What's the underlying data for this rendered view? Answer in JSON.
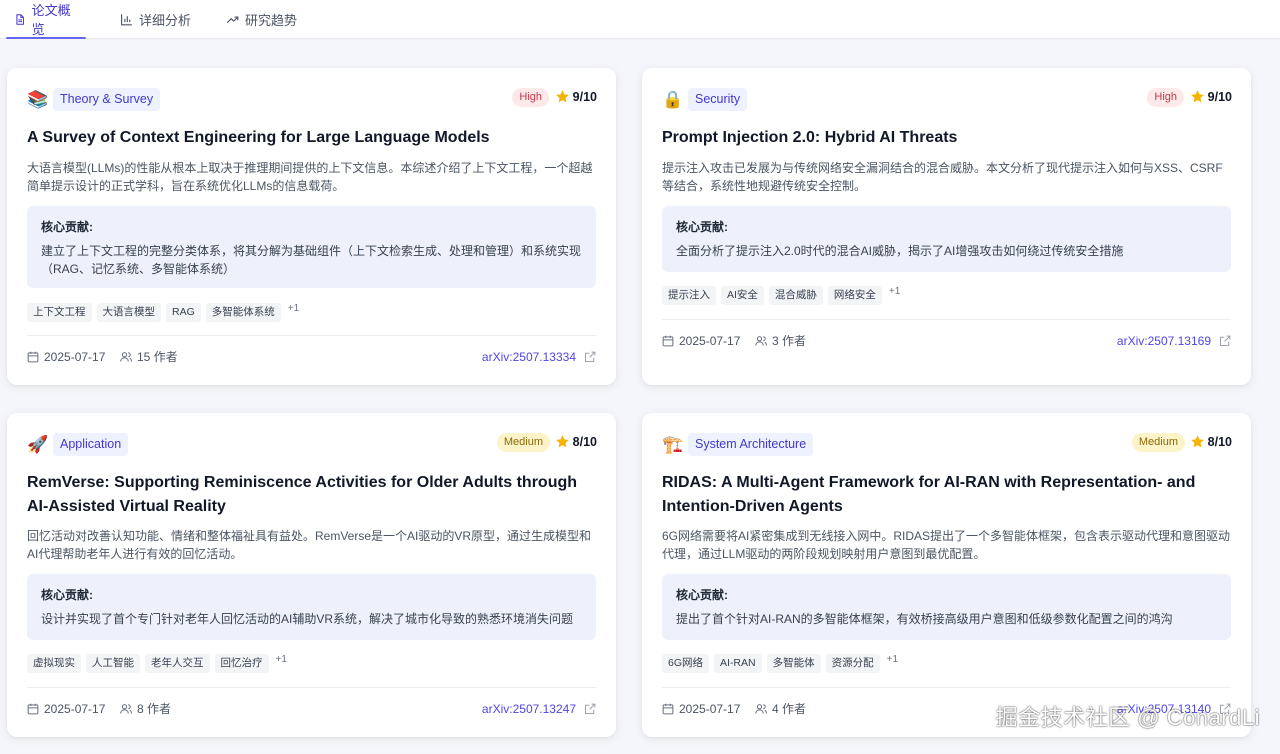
{
  "tabs": [
    {
      "label": "论文概览",
      "icon": "document-icon",
      "active": true
    },
    {
      "label": "详细分析",
      "icon": "bar-chart-icon",
      "active": false
    },
    {
      "label": "研究趋势",
      "icon": "trending-up-icon",
      "active": false
    }
  ],
  "contribution_label": "核心贡献:",
  "papers": [
    {
      "emoji": "📚",
      "category": "Theory & Survey",
      "priority": "High",
      "score": "9/10",
      "title": "A Survey of Context Engineering for Large Language Models",
      "summary": "大语言模型(LLMs)的性能从根本上取决于推理期间提供的上下文信息。本综述介绍了上下文工程，一个超越简单提示设计的正式学科，旨在系统优化LLMs的信息载荷。",
      "contribution": "建立了上下文工程的完整分类体系，将其分解为基础组件（上下文检索生成、处理和管理）和系统实现（RAG、记忆系统、多智能体系统）",
      "tags": [
        "上下文工程",
        "大语言模型",
        "RAG",
        "多智能体系统"
      ],
      "more": "+1",
      "date": "2025-07-17",
      "authors": "15 作者",
      "arxiv": "arXiv:2507.13334"
    },
    {
      "emoji": "🔒",
      "category": "Security",
      "priority": "High",
      "score": "9/10",
      "title": "Prompt Injection 2.0: Hybrid AI Threats",
      "summary": "提示注入攻击已发展为与传统网络安全漏洞结合的混合威胁。本文分析了现代提示注入如何与XSS、CSRF等结合，系统性地规避传统安全控制。",
      "contribution": "全面分析了提示注入2.0时代的混合AI威胁，揭示了AI增强攻击如何绕过传统安全措施",
      "tags": [
        "提示注入",
        "AI安全",
        "混合威胁",
        "网络安全"
      ],
      "more": "+1",
      "date": "2025-07-17",
      "authors": "3 作者",
      "arxiv": "arXiv:2507.13169"
    },
    {
      "emoji": "🚀",
      "category": "Application",
      "priority": "Medium",
      "score": "8/10",
      "title": "RemVerse: Supporting Reminiscence Activities for Older Adults through AI-Assisted Virtual Reality",
      "summary": "回忆活动对改善认知功能、情绪和整体福祉具有益处。RemVerse是一个AI驱动的VR原型，通过生成模型和AI代理帮助老年人进行有效的回忆活动。",
      "contribution": "设计并实现了首个专门针对老年人回忆活动的AI辅助VR系统，解决了城市化导致的熟悉环境消失问题",
      "tags": [
        "虚拟现实",
        "人工智能",
        "老年人交互",
        "回忆治疗"
      ],
      "more": "+1",
      "date": "2025-07-17",
      "authors": "8 作者",
      "arxiv": "arXiv:2507.13247"
    },
    {
      "emoji": "🏗️",
      "category": "System Architecture",
      "priority": "Medium",
      "score": "8/10",
      "title": "RIDAS: A Multi-Agent Framework for AI-RAN with Representation- and Intention-Driven Agents",
      "summary": "6G网络需要将AI紧密集成到无线接入网中。RIDAS提出了一个多智能体框架，包含表示驱动代理和意图驱动代理，通过LLM驱动的两阶段规划映射用户意图到最优配置。",
      "contribution": "提出了首个针对AI-RAN的多智能体框架，有效桥接高级用户意图和低级参数化配置之间的鸿沟",
      "tags": [
        "6G网络",
        "AI-RAN",
        "多智能体",
        "资源分配"
      ],
      "more": "+1",
      "date": "2025-07-17",
      "authors": "4 作者",
      "arxiv": "arXiv:2507.13140"
    }
  ],
  "watermark": "掘金技术社区 @ ConardLi",
  "colors": {
    "accent": "#4f46e5",
    "high": "#c53b4a",
    "medium": "#8a6a06",
    "star": "#f5b301"
  }
}
